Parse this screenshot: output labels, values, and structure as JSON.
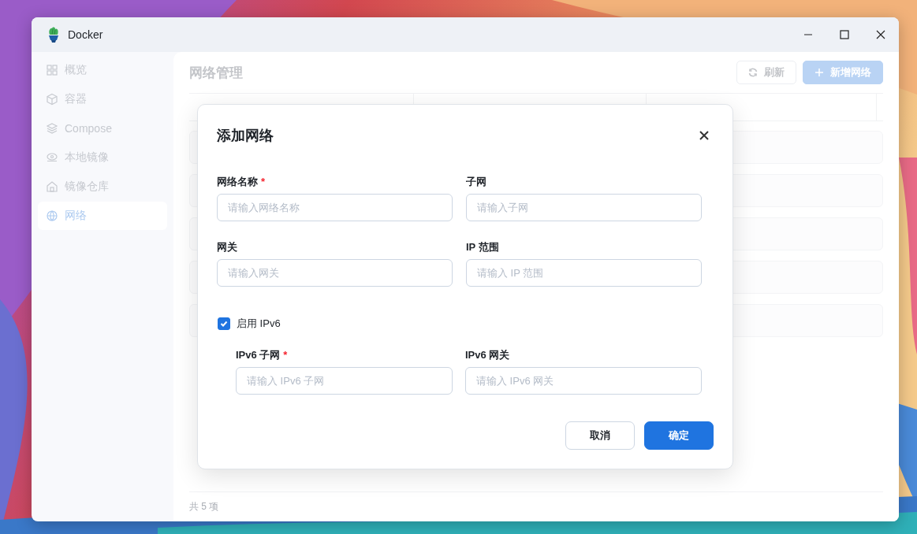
{
  "window": {
    "title": "Docker"
  },
  "sidebar": {
    "items": [
      {
        "label": "概览",
        "selected": false
      },
      {
        "label": "容器",
        "selected": false
      },
      {
        "label": "Compose",
        "selected": false
      },
      {
        "label": "本地镜像",
        "selected": false
      },
      {
        "label": "镜像仓库",
        "selected": false
      },
      {
        "label": "网络",
        "selected": true
      }
    ]
  },
  "page": {
    "title": "网络管理",
    "buttons": [
      {
        "label": "刷新",
        "kind": "secondary"
      },
      {
        "label": "新增网络",
        "kind": "primary"
      }
    ],
    "footer": "共 5 项"
  },
  "dialog": {
    "title": "添加网络",
    "fields": [
      {
        "label": "网络名称",
        "required_mark": "*",
        "placeholder": "请输入网络名称"
      },
      {
        "label": "子网",
        "placeholder": "请输入子网"
      },
      {
        "label": "网关",
        "placeholder": "请输入网关"
      },
      {
        "label": "IP 范围",
        "placeholder": "请输入 IP 范围"
      }
    ],
    "ipv6": {
      "label": "启用 IPv6",
      "checked": true,
      "fields": [
        {
          "label": "IPv6 子网",
          "required_mark": "*",
          "placeholder": "请输入 IPv6 子网"
        },
        {
          "label": "IPv6 网关",
          "placeholder": "请输入 IPv6 网关"
        }
      ]
    },
    "buttons": [
      {
        "label": "取消",
        "kind": "secondary"
      },
      {
        "label": "确定",
        "kind": "primary"
      }
    ]
  }
}
